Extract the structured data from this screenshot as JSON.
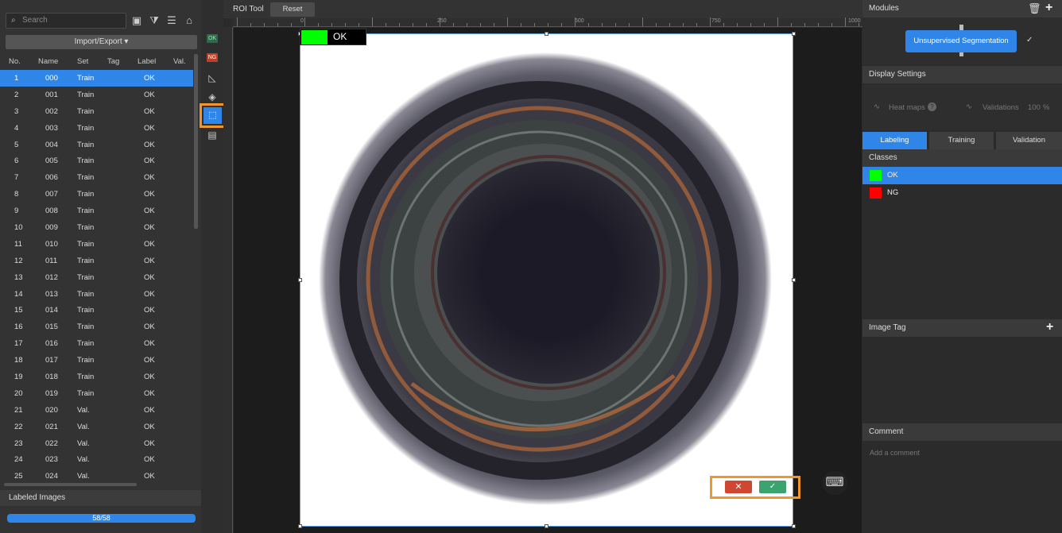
{
  "left_panel": {
    "search_placeholder": "Search",
    "import_export": "Import/Export ▾",
    "columns": [
      "No.",
      "Name",
      "Set",
      "Tag",
      "Label",
      "Val."
    ],
    "rows": [
      {
        "no": "1",
        "name": "000",
        "set": "Train",
        "label": "OK"
      },
      {
        "no": "2",
        "name": "001",
        "set": "Train",
        "label": "OK"
      },
      {
        "no": "3",
        "name": "002",
        "set": "Train",
        "label": "OK"
      },
      {
        "no": "4",
        "name": "003",
        "set": "Train",
        "label": "OK"
      },
      {
        "no": "5",
        "name": "004",
        "set": "Train",
        "label": "OK"
      },
      {
        "no": "6",
        "name": "005",
        "set": "Train",
        "label": "OK"
      },
      {
        "no": "7",
        "name": "006",
        "set": "Train",
        "label": "OK"
      },
      {
        "no": "8",
        "name": "007",
        "set": "Train",
        "label": "OK"
      },
      {
        "no": "9",
        "name": "008",
        "set": "Train",
        "label": "OK"
      },
      {
        "no": "10",
        "name": "009",
        "set": "Train",
        "label": "OK"
      },
      {
        "no": "11",
        "name": "010",
        "set": "Train",
        "label": "OK"
      },
      {
        "no": "12",
        "name": "011",
        "set": "Train",
        "label": "OK"
      },
      {
        "no": "13",
        "name": "012",
        "set": "Train",
        "label": "OK"
      },
      {
        "no": "14",
        "name": "013",
        "set": "Train",
        "label": "OK"
      },
      {
        "no": "15",
        "name": "014",
        "set": "Train",
        "label": "OK"
      },
      {
        "no": "16",
        "name": "015",
        "set": "Train",
        "label": "OK"
      },
      {
        "no": "17",
        "name": "016",
        "set": "Train",
        "label": "OK"
      },
      {
        "no": "18",
        "name": "017",
        "set": "Train",
        "label": "OK"
      },
      {
        "no": "19",
        "name": "018",
        "set": "Train",
        "label": "OK"
      },
      {
        "no": "20",
        "name": "019",
        "set": "Train",
        "label": "OK"
      },
      {
        "no": "21",
        "name": "020",
        "set": "Val.",
        "label": "OK"
      },
      {
        "no": "22",
        "name": "021",
        "set": "Val.",
        "label": "OK"
      },
      {
        "no": "23",
        "name": "022",
        "set": "Val.",
        "label": "OK"
      },
      {
        "no": "24",
        "name": "023",
        "set": "Val.",
        "label": "OK"
      },
      {
        "no": "25",
        "name": "024",
        "set": "Val.",
        "label": "OK"
      }
    ],
    "selected_row": 0,
    "labeled_title": "Labeled Images",
    "labeled_progress": "58/58",
    "labeled_fraction": 1.0
  },
  "tool_strip": {
    "ok_badge": "OK",
    "ng_badge": "NG"
  },
  "toolbar": {
    "roi_label": "ROI Tool",
    "reset_label": "Reset"
  },
  "ruler": {
    "h_labels": [
      "0",
      "250",
      "500",
      "750",
      "1000"
    ]
  },
  "canvas": {
    "class_tag": "OK",
    "class_color": "#00ff00"
  },
  "right_panel": {
    "modules_title": "Modules",
    "module_name": "Unsupervised Segmentation",
    "module_check": "✓",
    "display_title": "Display Settings",
    "heatmaps_label": "Heat maps",
    "validations_label": "Validations",
    "validations_value": "100",
    "validations_unit": "%",
    "tabs": [
      "Labeling",
      "Training",
      "Validation"
    ],
    "active_tab": 0,
    "classes_title": "Classes",
    "classes": [
      {
        "name": "OK",
        "color": "#00ff00"
      },
      {
        "name": "NG",
        "color": "#ff0000"
      }
    ],
    "image_tag_title": "Image Tag",
    "comment_title": "Comment",
    "comment_placeholder": "Add a comment"
  },
  "colors": {
    "accent": "#2f86e8",
    "highlight": "#f0962b",
    "reject": "#cf4731",
    "accept": "#3aa36e"
  }
}
